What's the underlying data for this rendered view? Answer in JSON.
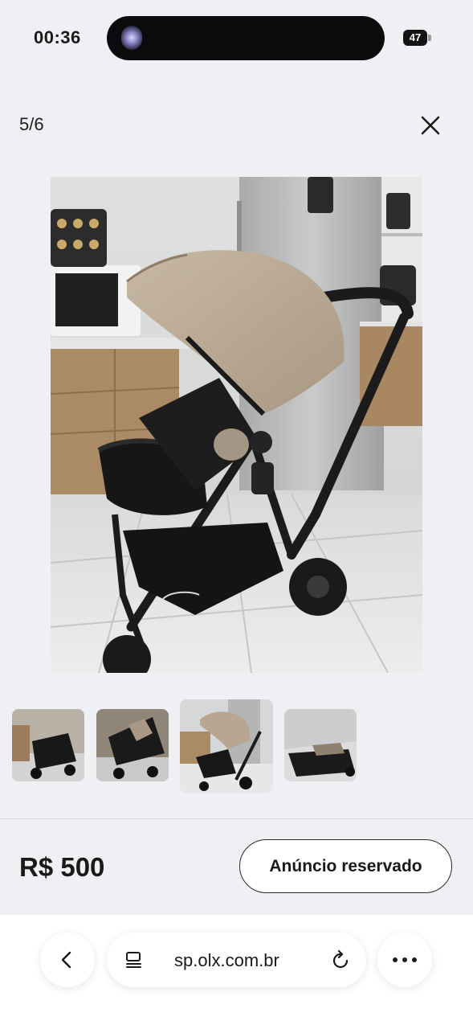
{
  "status_bar": {
    "time": "00:36",
    "battery": "47"
  },
  "viewer": {
    "counter": "5/6",
    "close_icon": "close-icon",
    "main_photo": "baby stroller with beige canopy in kitchen",
    "thumbnails": [
      {
        "icon": "stroller-photo-1",
        "selected": false
      },
      {
        "icon": "stroller-photo-2",
        "selected": false
      },
      {
        "icon": "stroller-photo-3",
        "selected": true
      },
      {
        "icon": "stroller-photo-4",
        "selected": false
      }
    ]
  },
  "listing": {
    "price": "R$ 500",
    "reserved_button": "Anúncio reservado"
  },
  "browser": {
    "url": "sp.olx.com.br",
    "back_icon": "chevron-left-icon",
    "tabs_icon": "tab-settings-icon",
    "reload_icon": "reload-icon",
    "more_icon": "more-dots-icon"
  },
  "colors": {
    "background": "#eef0f4",
    "text": "#1a1a1a",
    "canopy": "#b7a692",
    "stroller_body": "#1c1c1e"
  }
}
